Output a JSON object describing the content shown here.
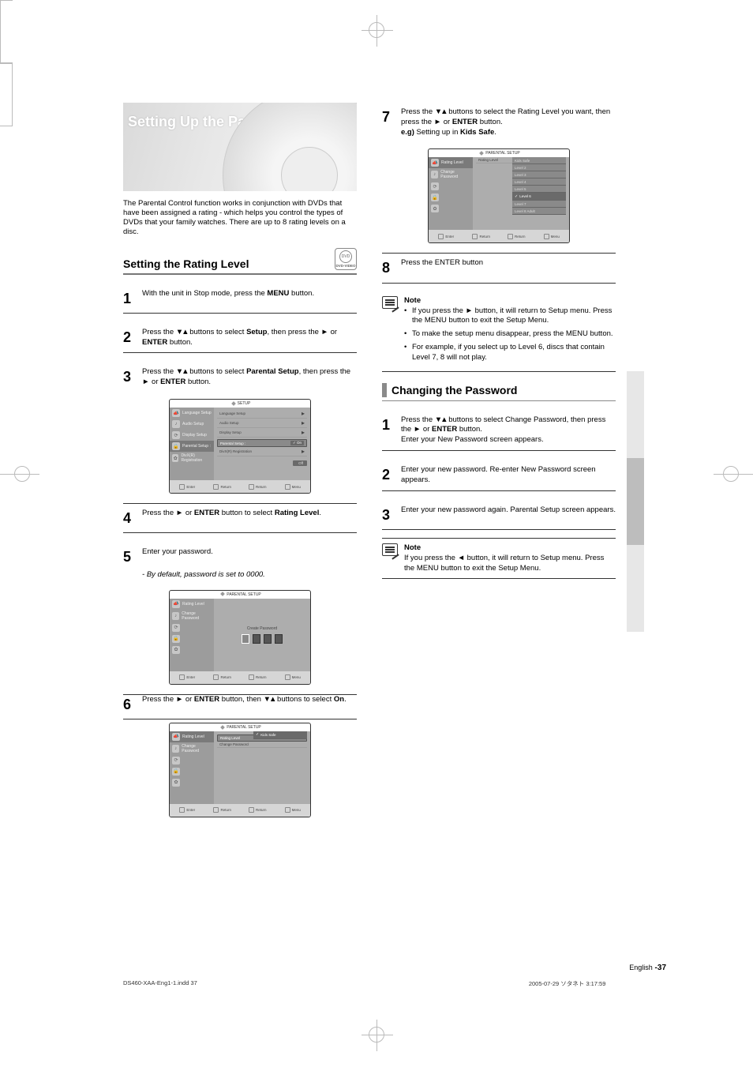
{
  "hero": {
    "title": "Setting Up the Parental Control"
  },
  "intro": "The Parental Control function works in conjunction with DVDs that have been assigned a rating - which helps you control the types of DVDs that your family watches. There are up to 8 rating levels on a disc.",
  "dvd_icon": {
    "inner": "DVD",
    "label": "DVD-VIDEO"
  },
  "section_set_rating": "Setting the Rating Level",
  "step1_text": "With the unit in Stop mode, press the MENU button.",
  "step2_text": "Press the ▼▲ buttons to select Setup, then press the ► or ENTER button.",
  "step3_text": "Press the ▼▲ buttons to select Parental Setup, then press the ► or ENTER button.",
  "ss_common": {
    "title_setup": "SETUP",
    "title_parental": "PARENTAL SETUP",
    "left": [
      {
        "icon": "📣",
        "label": "Language Setup"
      },
      {
        "icon": "♪",
        "label": "Audio Setup"
      },
      {
        "icon": "⟳",
        "label": "Display Setup"
      },
      {
        "icon": "🔒",
        "label": "Parental Setup :"
      },
      {
        "icon": "✿",
        "label": "DivX(R) Registration"
      }
    ],
    "left_short": [
      {
        "icon": "📣",
        "label": "Rating Level"
      },
      {
        "icon": "♪",
        "label": "Change Password"
      },
      {
        "icon": "⟳",
        "label": ""
      },
      {
        "icon": "🔒",
        "label": ""
      },
      {
        "icon": "✿",
        "label": ""
      }
    ],
    "right_rows": [
      "Language Setup",
      "Audio Setup",
      "Display Setup",
      "Parental Setup :",
      "DivX(R) Registration"
    ],
    "footer": [
      {
        "k": "Enter"
      },
      {
        "k": "Return"
      },
      {
        "k": "Return"
      },
      {
        "k": "Menu"
      }
    ],
    "dropdown_rating": {
      "top": "Kids Safe",
      "items": [
        "Level 2",
        "Level 3",
        "Level 4",
        "Level 5",
        "Level 6",
        "Level 7",
        "Level 8 Adult"
      ]
    },
    "dropdown_onoff": {
      "on": "On",
      "off": "Off"
    },
    "dropdown_kids": {
      "top": "Kids Safe"
    },
    "create_pw": "Create Password",
    "rating_label": "Rating Level",
    "change_pw_label": "Change Password"
  },
  "step4_text": "Press the ► or ENTER button to select Rating Level.",
  "step5_text": "Enter your password.",
  "step5_sub": "By default, password is set to 0000.",
  "step6_text": "Press the ► or ENTER button, then ▼▲ buttons to select On.",
  "step7_text": "Press the ▼▲ buttons to select the Rating Level you want, then press the ► or ENTER button.",
  "step7_eg": "e.g) Setting up in Kids Safe.",
  "step8_text": "Press the ENTER button",
  "step8_sub": "To make the setup menu disappear, press the MENU button.",
  "step8_sub2": "For example, if you select up to Level 6, discs that contain Level 7, 8 will not play.",
  "note1": "If you press the ► button, it will return to Setup menu. Press the MENU button to exit the Setup Menu.",
  "section_change_pw": "Changing the Password",
  "cpw1_text": "Press the ▼▲ buttons to select Change Password, then press the ► or ENTER button.",
  "cpw1_sub": "Enter your New Password screen appears.",
  "cpw2_text": "Enter your new password. Re-enter New Password screen appears.",
  "cpw3_text": "Enter your new password again. Parental Setup screen appears.",
  "note2": "If you press the ◄ button, it will return to Setup menu. Press the MENU button to exit the Setup Menu.",
  "page": {
    "lang": "English",
    "num": "-37"
  },
  "proof": "DS460-XAA-Eng1-1.indd   37",
  "proof_time": "2005-07-29   ソタネト 3:17:59",
  "screenshot_alts": {
    "ss_a": "SETUP menu — Parental Setup highlighted with On/Off dropdown",
    "ss_b": "PARENTAL SETUP — Create Password entry boxes",
    "ss_c": "PARENTAL SETUP — Rating Level dropdown with Kids Safe selected",
    "ss_d": "PARENTAL SETUP — Rating Level list Kids Safe through Level 8 Adult"
  }
}
